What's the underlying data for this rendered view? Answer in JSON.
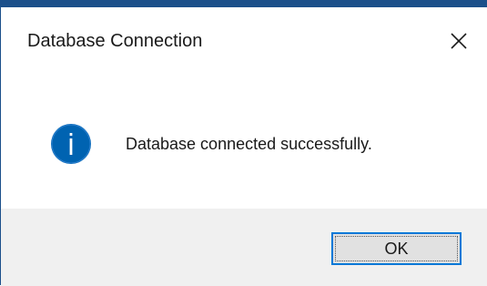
{
  "dialog": {
    "title": "Database Connection",
    "message": "Database connected successfully.",
    "ok_label": "OK"
  },
  "icons": {
    "close": "close-icon",
    "info": "info-icon"
  },
  "colors": {
    "accent": "#1b4f8a",
    "info_icon": "#0063b1",
    "button_focus": "#0078d7",
    "footer_bg": "#f0f0f0"
  }
}
